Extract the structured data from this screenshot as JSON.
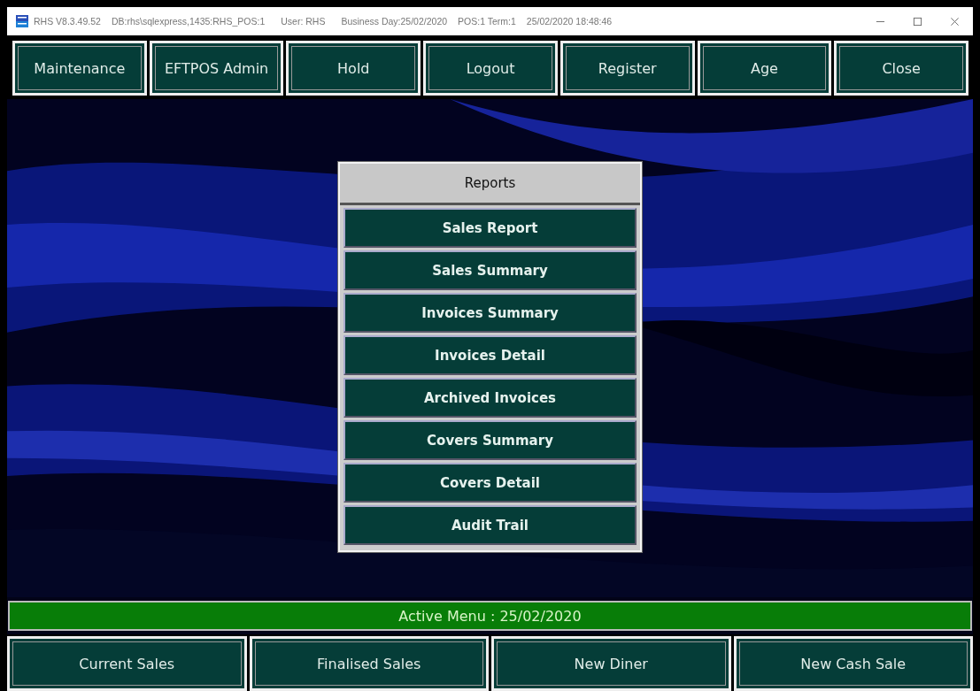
{
  "window": {
    "title_parts": [
      "RHS V8.3.49.52",
      "DB:rhs\\sqlexpress,1435:RHS_POS:1",
      "User: RHS",
      "Business Day:25/02/2020",
      "POS:1 Term:1",
      "25/02/2020 18:48:46"
    ]
  },
  "toolbar": [
    "Maintenance",
    "EFTPOS Admin",
    "Hold",
    "Logout",
    "Register",
    "Age",
    "Close"
  ],
  "menu": {
    "title": "Reports",
    "items": [
      "Sales Report",
      "Sales Summary",
      "Invoices Summary",
      "Invoices Detail",
      "Archived Invoices",
      "Covers Summary",
      "Covers Detail",
      "Audit Trail"
    ]
  },
  "status_bar": "Active Menu : 25/02/2020",
  "bottom_buttons": [
    "Current Sales",
    "Finalised Sales",
    "New Diner",
    "New Cash Sale"
  ]
}
